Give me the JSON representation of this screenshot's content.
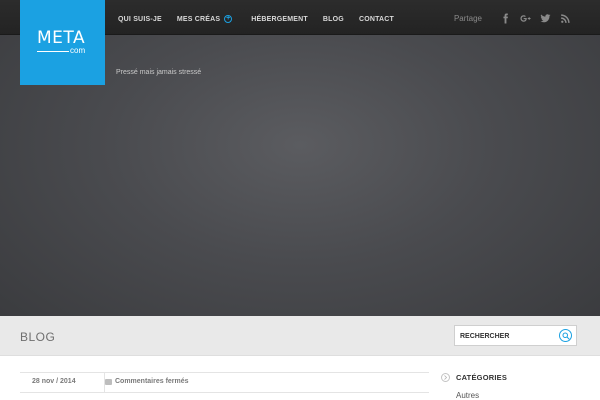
{
  "logo": {
    "main": "META",
    "sub": "com"
  },
  "nav": {
    "items": [
      {
        "label": "QUI SUIS-JE"
      },
      {
        "label": "MES CRÉAS"
      },
      {
        "label": "HÉBERGEMENT"
      },
      {
        "label": "BLOG"
      },
      {
        "label": "CONTACT"
      }
    ]
  },
  "share": {
    "label": "Partage",
    "icons": [
      "facebook-icon",
      "google-plus-icon",
      "twitter-icon",
      "rss-icon"
    ]
  },
  "hero": {
    "tagline": "Pressé mais jamais stressé"
  },
  "blogbar": {
    "title": "BLOG",
    "search_placeholder": "RECHERCHER"
  },
  "post": {
    "date": "28 nov / 2014",
    "comments": "Commentaires fermés"
  },
  "sidebar": {
    "categories_title": "CATÉGORIES",
    "categories": [
      "Autres"
    ]
  },
  "colors": {
    "accent": "#1ba1e2",
    "topbar": "#2a2a2a",
    "hero": "#4a4b4f"
  }
}
